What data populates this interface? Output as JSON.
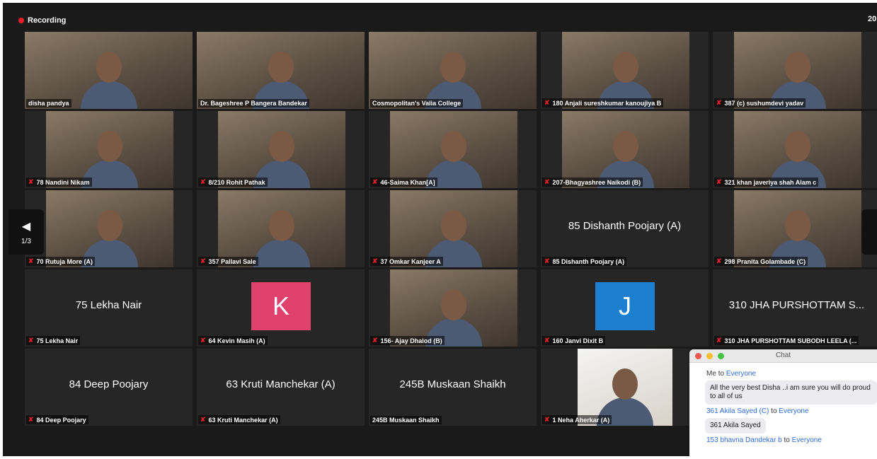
{
  "recording_label": "Recording",
  "participant_count": "20",
  "pager": {
    "prev_page": "1/3"
  },
  "tiles": [
    {
      "name": "disha pandya",
      "muted": false,
      "video": true
    },
    {
      "name": "Dr. Bageshree P Bangera Bandekar",
      "muted": false,
      "video": true
    },
    {
      "name": "Cosmopolitan's Valia College",
      "muted": false,
      "video": true,
      "active": true
    },
    {
      "name": "180 Anjali sureshkumar kanoujiya B",
      "muted": true,
      "video": true
    },
    {
      "name": "387 (c) sushumdevi  yadav",
      "muted": true,
      "video": true
    },
    {
      "name": "78 Nandini Nikam",
      "muted": true,
      "video": true
    },
    {
      "name": "8/210 Rohit Pathak",
      "muted": true,
      "video": true
    },
    {
      "name": "46-Saima Khan[A]",
      "muted": true,
      "video": true
    },
    {
      "name": "207-Bhagyashree Naikodi (B)",
      "muted": true,
      "video": true
    },
    {
      "name": "321 khan javeriya shah Alam c",
      "muted": true,
      "video": true
    },
    {
      "name": "70 Rutuja More (A)",
      "muted": true,
      "video": true
    },
    {
      "name": "357 Pallavi Sale",
      "muted": true,
      "video": true
    },
    {
      "name": "37  Omkar Kanjeer A",
      "muted": true,
      "video": true
    },
    {
      "name": "85 Dishanth Poojary (A)",
      "muted": true,
      "video": false,
      "display_name": "85 Dishanth Poojary (A)"
    },
    {
      "name": "298 Pranita Golambade (C)",
      "muted": true,
      "video": true
    },
    {
      "name": "75 Lekha Nair",
      "muted": true,
      "video": false,
      "display_name": "75 Lekha Nair"
    },
    {
      "name": "64 Kevin Masih (A)",
      "muted": true,
      "video": false,
      "avatar_letter": "K",
      "avatar_color": "#e0416d"
    },
    {
      "name": "156- Ajay Dhalod (B)",
      "muted": true,
      "video": true
    },
    {
      "name": "160 Janvi Dixit B",
      "muted": true,
      "video": false,
      "avatar_letter": "J",
      "avatar_color": "#1d7fd0"
    },
    {
      "name": "310 JHA PURSHOTTAM SUBODH LEELA (...",
      "muted": true,
      "video": false,
      "display_name": "310 JHA PURSHOTTAM S..."
    },
    {
      "name": "84 Deep Poojary",
      "muted": true,
      "video": false,
      "display_name": "84 Deep Poojary"
    },
    {
      "name": "63 Kruti Manchekar (A)",
      "muted": true,
      "video": false,
      "display_name": "63 Kruti Manchekar (A)"
    },
    {
      "name": "245B Muskaan Shaikh",
      "muted": false,
      "video": false,
      "display_name": "245B Muskaan Shaikh"
    },
    {
      "name": "1 Neha Aherkar (A)",
      "muted": true,
      "video": true,
      "narrow": true
    }
  ],
  "chat": {
    "title": "Chat",
    "messages": [
      {
        "from": "Me",
        "to_word": "to",
        "to": "Everyone",
        "text": "All the very best Disha ..i am sure you will do proud to all of us"
      },
      {
        "from": "361 Akila Sayed (C)",
        "to_word": "to",
        "to": "Everyone",
        "text": "361 Akila Sayed"
      },
      {
        "from": "153 bhavna Dandekar b",
        "to_word": "to",
        "to": "Everyone",
        "text": ""
      }
    ]
  },
  "colors": {
    "background": "#1a1a1a",
    "tile": "#262626",
    "active_border": "#f0e05a",
    "recording_dot": "#e8202a",
    "chat_link": "#2d6bd3"
  }
}
